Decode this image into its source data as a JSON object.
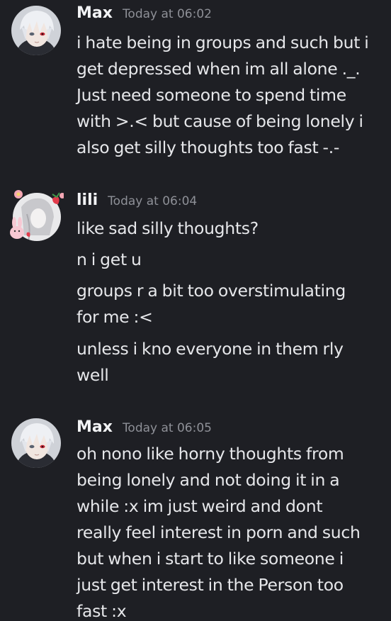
{
  "messages": [
    {
      "author": "Max",
      "timestamp": "Today at 06:02",
      "lines": [
        "i hate being in groups and such but i\nget depressed when im all alone ._.\nJust need someone to spend time\nwith >.< but cause of being lonely i\nalso get silly thoughts too fast -.-"
      ]
    },
    {
      "author": "lili",
      "timestamp": "Today at 06:04",
      "lines": [
        "like sad silly thoughts?",
        "n i get u",
        "groups r a bit too overstimulating\nfor me :<",
        "unless i kno everyone in them rly\nwell"
      ]
    },
    {
      "author": "Max",
      "timestamp": "Today at 06:05",
      "lines": [
        "oh nono like horny thoughts from\nbeing lonely and not doing it in a\nwhile :x im just weird and dont\nreally feel interest in porn and such\nbut when i start to like someone i\njust get interest in the Person too\nfast :x"
      ]
    }
  ],
  "icons": {
    "max_avatar": "anime-boy-white-hair-avatar-icon",
    "lili_avatar": "bunny-strawberry-decorated-avatar-icon"
  },
  "colors": {
    "background": "#1e1f24",
    "username": "#f2f3f5",
    "timestamp": "#8e9097",
    "message_text": "#e6e7ea"
  }
}
